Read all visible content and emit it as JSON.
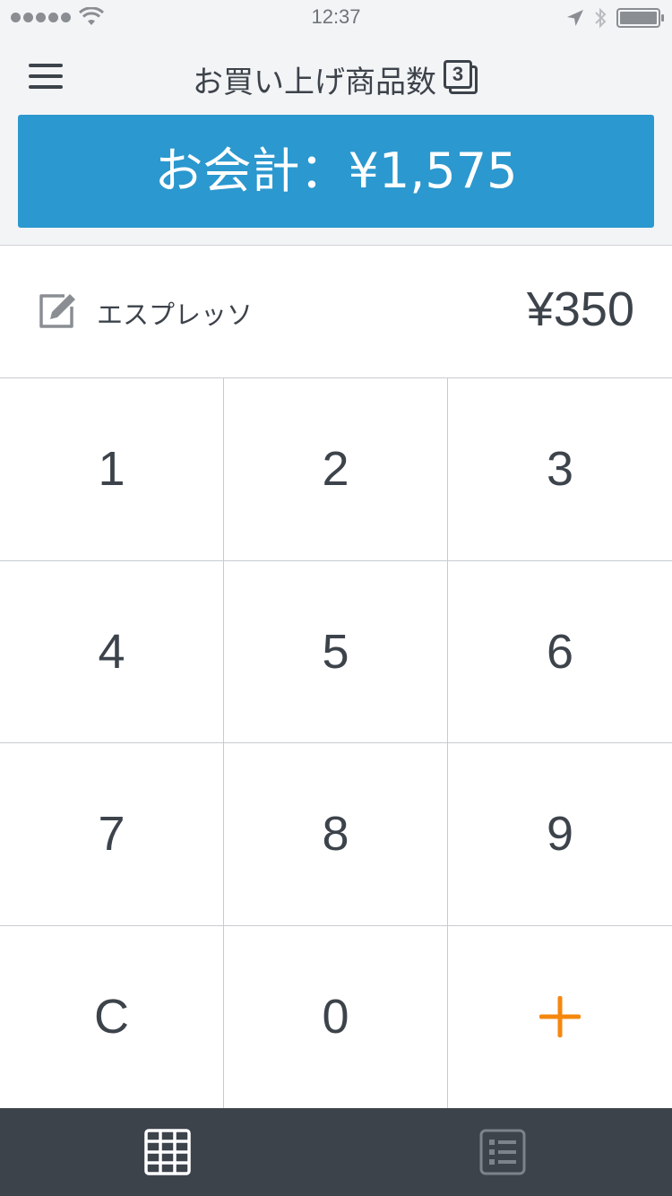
{
  "status_bar": {
    "time": "12:37"
  },
  "header": {
    "title": "お買い上げ商品数",
    "item_count": "3"
  },
  "checkout": {
    "label": "お会計：¥1,575"
  },
  "current_item": {
    "name": "エスプレッソ",
    "price": "¥350"
  },
  "keypad": {
    "keys": [
      "1",
      "2",
      "3",
      "4",
      "5",
      "6",
      "7",
      "8",
      "9",
      "C",
      "0"
    ]
  },
  "colors": {
    "accent_blue": "#2b98cf",
    "plus_orange": "#f5870f",
    "tab_bar_bg": "#3d434b",
    "text_dark": "#3d434b"
  },
  "icons": {
    "menu": "hamburger-menu-icon",
    "edit": "edit-pencil-icon",
    "add": "plus-icon",
    "tab_keypad": "keypad-grid-icon",
    "tab_list": "item-list-icon"
  }
}
